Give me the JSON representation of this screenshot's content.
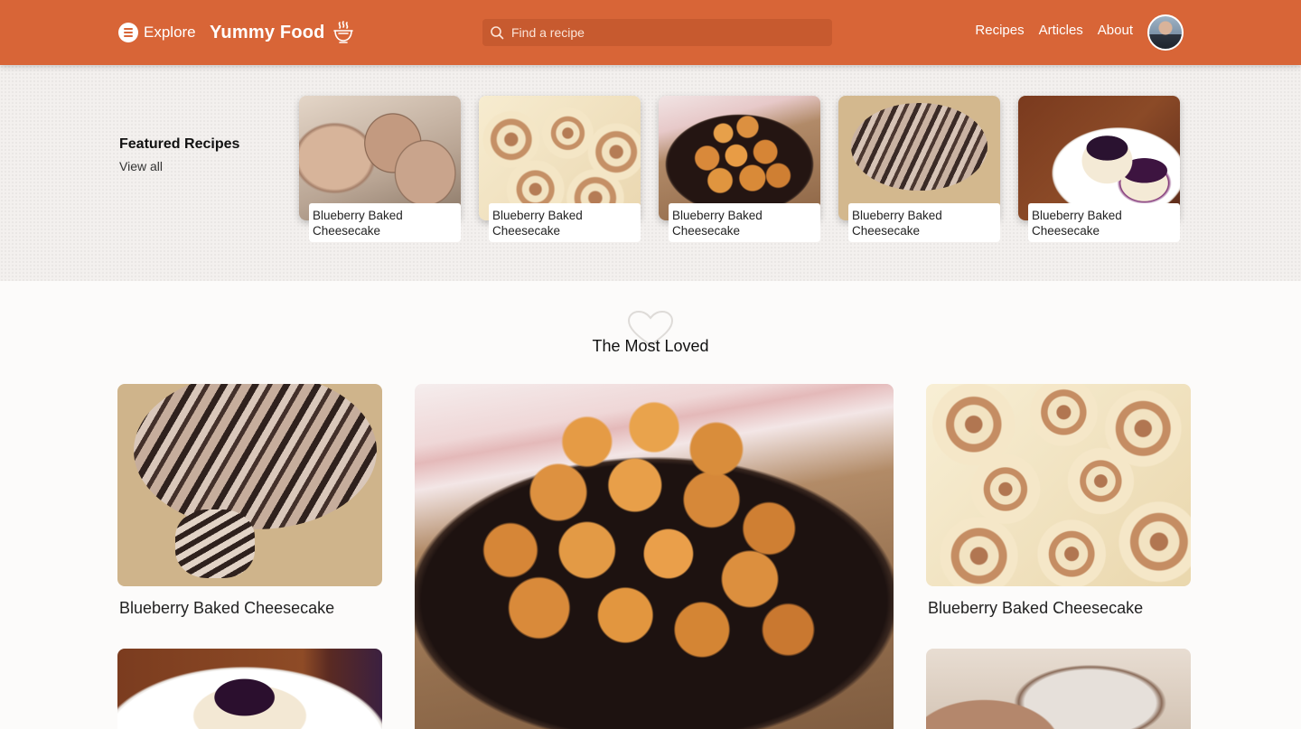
{
  "header": {
    "explore_label": "Explore",
    "brand_name": "Yummy Food",
    "search_placeholder": "Find a recipe",
    "nav": [
      "Recipes",
      "Articles",
      "About"
    ],
    "colors": {
      "header_bg": "#d86537",
      "search_bg": "#c75a2f"
    }
  },
  "featured": {
    "title": "Featured Recipes",
    "view_all": "View all",
    "cards": [
      {
        "title": "Blueberry Baked Cheesecake",
        "image": "bread-loaf"
      },
      {
        "title": "Blueberry Baked Cheesecake",
        "image": "cinnamon-rolls"
      },
      {
        "title": "Blueberry Baked Cheesecake",
        "image": "syrup-donuts"
      },
      {
        "title": "Blueberry Baked Cheesecake",
        "image": "chocolate-babka"
      },
      {
        "title": "Blueberry Baked Cheesecake",
        "image": "mini-cheesecakes"
      }
    ]
  },
  "most_loved": {
    "title": "The Most Loved",
    "icon": "heart-icon",
    "cards": [
      {
        "title": "Blueberry Baked Cheesecake",
        "image": "chocolate-babka"
      },
      {
        "title": "",
        "image": "syrup-donuts"
      },
      {
        "title": "Blueberry Baked Cheesecake",
        "image": "cinnamon-rolls"
      },
      {
        "title": "",
        "image": "mini-cheesecakes"
      },
      {
        "title": "",
        "image": "bread-loaf"
      }
    ]
  }
}
